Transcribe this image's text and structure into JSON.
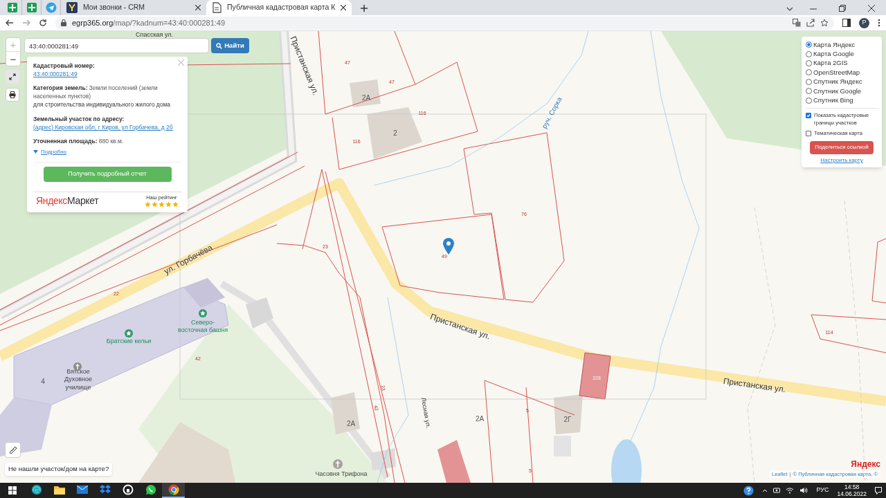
{
  "browser": {
    "pinned_tabs": [
      {
        "kind": "sheets"
      },
      {
        "kind": "sheets"
      },
      {
        "kind": "telegram"
      }
    ],
    "tabs": [
      {
        "kind": "crm",
        "title": "Мои звонки - CRM",
        "selected": false
      },
      {
        "kind": "page",
        "title": "Публичная кадастровая карта К",
        "selected": true
      }
    ],
    "address": {
      "host": "egrp365.org",
      "path": "/map/?kadnum=43:40:000281:49"
    },
    "profile": "P"
  },
  "search": {
    "value": "43:40:000281:49",
    "button": "Найти"
  },
  "zoom": {
    "in": "+",
    "out": "−"
  },
  "popup": {
    "fields": [
      {
        "kind": "link",
        "label": "Кадастровый номер:",
        "value": "43:40:000281:49"
      },
      {
        "kind": "text",
        "label": "Категория земель:",
        "value": "Земли поселений (земли населенных пунктов)"
      },
      {
        "kind": "note",
        "value": "для строительства индивидуального жилого дома"
      },
      {
        "kind": "link",
        "label": "Земельный участок по адресу:",
        "value": "(адрес) Кировская обл, г Киров, ул Горбачева, д 2б"
      },
      {
        "kind": "text",
        "label": "Уточненная площадь:",
        "value": "880 кв.м."
      }
    ],
    "more": "Подробно",
    "button": "Получить подробный отчет",
    "brand": {
      "first": "Яндекс",
      "second": "Маркет"
    },
    "rating_label": "Наш рейтинг",
    "stars": 5
  },
  "layers": {
    "options": [
      {
        "label": "Карта Яндекс",
        "selected": true
      },
      {
        "label": "Карта Google",
        "selected": false
      },
      {
        "label": "Карта 2GIS",
        "selected": false
      },
      {
        "label": "OpenStreetMap",
        "selected": false
      },
      {
        "label": "Спутник Яндекс",
        "selected": false
      },
      {
        "label": "Спутник Google",
        "selected": false
      },
      {
        "label": "Спутник Bing",
        "selected": false
      }
    ],
    "toggles": [
      {
        "label": "Показать кадастровые границы участков",
        "checked": true
      },
      {
        "label": "Тематическая карта",
        "checked": false
      }
    ],
    "share": "Поделиться ссылкой",
    "settings": "Настроить карту"
  },
  "map_labels": [
    {
      "kind": "street_small",
      "text": "Спасская ул."
    },
    {
      "kind": "street",
      "text": "Пристанская ул."
    },
    {
      "kind": "parcel",
      "text": "47"
    },
    {
      "kind": "parcel",
      "text": "47"
    },
    {
      "kind": "house",
      "text": "2А"
    },
    {
      "kind": "parcel",
      "text": "116"
    },
    {
      "kind": "house",
      "text": "2"
    },
    {
      "kind": "parcel",
      "text": "116"
    },
    {
      "kind": "water",
      "text": "руч. Сорка"
    },
    {
      "kind": "parcel",
      "text": "76"
    },
    {
      "kind": "parcel",
      "text": "49"
    },
    {
      "kind": "parcel",
      "text": "23"
    },
    {
      "kind": "street",
      "text": "ул. Горбачёва"
    },
    {
      "kind": "parcel",
      "text": "22"
    },
    {
      "kind": "poi",
      "text": "Северо-\nвосточная башня"
    },
    {
      "kind": "poi",
      "text": "Братские кельи"
    },
    {
      "kind": "parcel",
      "text": "42"
    },
    {
      "kind": "house",
      "text": "4"
    },
    {
      "kind": "poi_grey",
      "text": "Вятское\nДуховное\nучилище"
    },
    {
      "kind": "street",
      "text": "Пристанская ул."
    },
    {
      "kind": "street",
      "text": "Пристанская ул."
    },
    {
      "kind": "parcel",
      "text": "114"
    },
    {
      "kind": "parcel_light",
      "text": "228"
    },
    {
      "kind": "parcel",
      "text": "23"
    },
    {
      "kind": "parcel",
      "text": "42"
    },
    {
      "kind": "street_small",
      "text": "Лесная ул."
    },
    {
      "kind": "house",
      "text": "2А"
    },
    {
      "kind": "parcel",
      "text": "5"
    },
    {
      "kind": "house",
      "text": "2Г"
    },
    {
      "kind": "house",
      "text": "2А"
    },
    {
      "kind": "parcel",
      "text": "5"
    },
    {
      "kind": "poi_grey",
      "text": "Часовня Трифона"
    }
  ],
  "not_found": "Не нашли участок/дом на карте?",
  "attribution": {
    "leaflet": "Leaflet",
    "separator": "|",
    "source": "© Публичная кадастровая карта, ©",
    "logo": "Яндекс"
  },
  "taskbar": {
    "apps": [
      {
        "kind": "edge",
        "selected": false
      },
      {
        "kind": "folder",
        "selected": false
      },
      {
        "kind": "mail",
        "selected": false
      },
      {
        "kind": "dropbox",
        "selected": false
      },
      {
        "kind": "circle",
        "selected": false
      },
      {
        "kind": "whatsapp",
        "selected": false
      },
      {
        "kind": "chrome",
        "selected": true
      }
    ],
    "lang": "РУС",
    "time": "14:58",
    "date": "14.06.2022"
  }
}
